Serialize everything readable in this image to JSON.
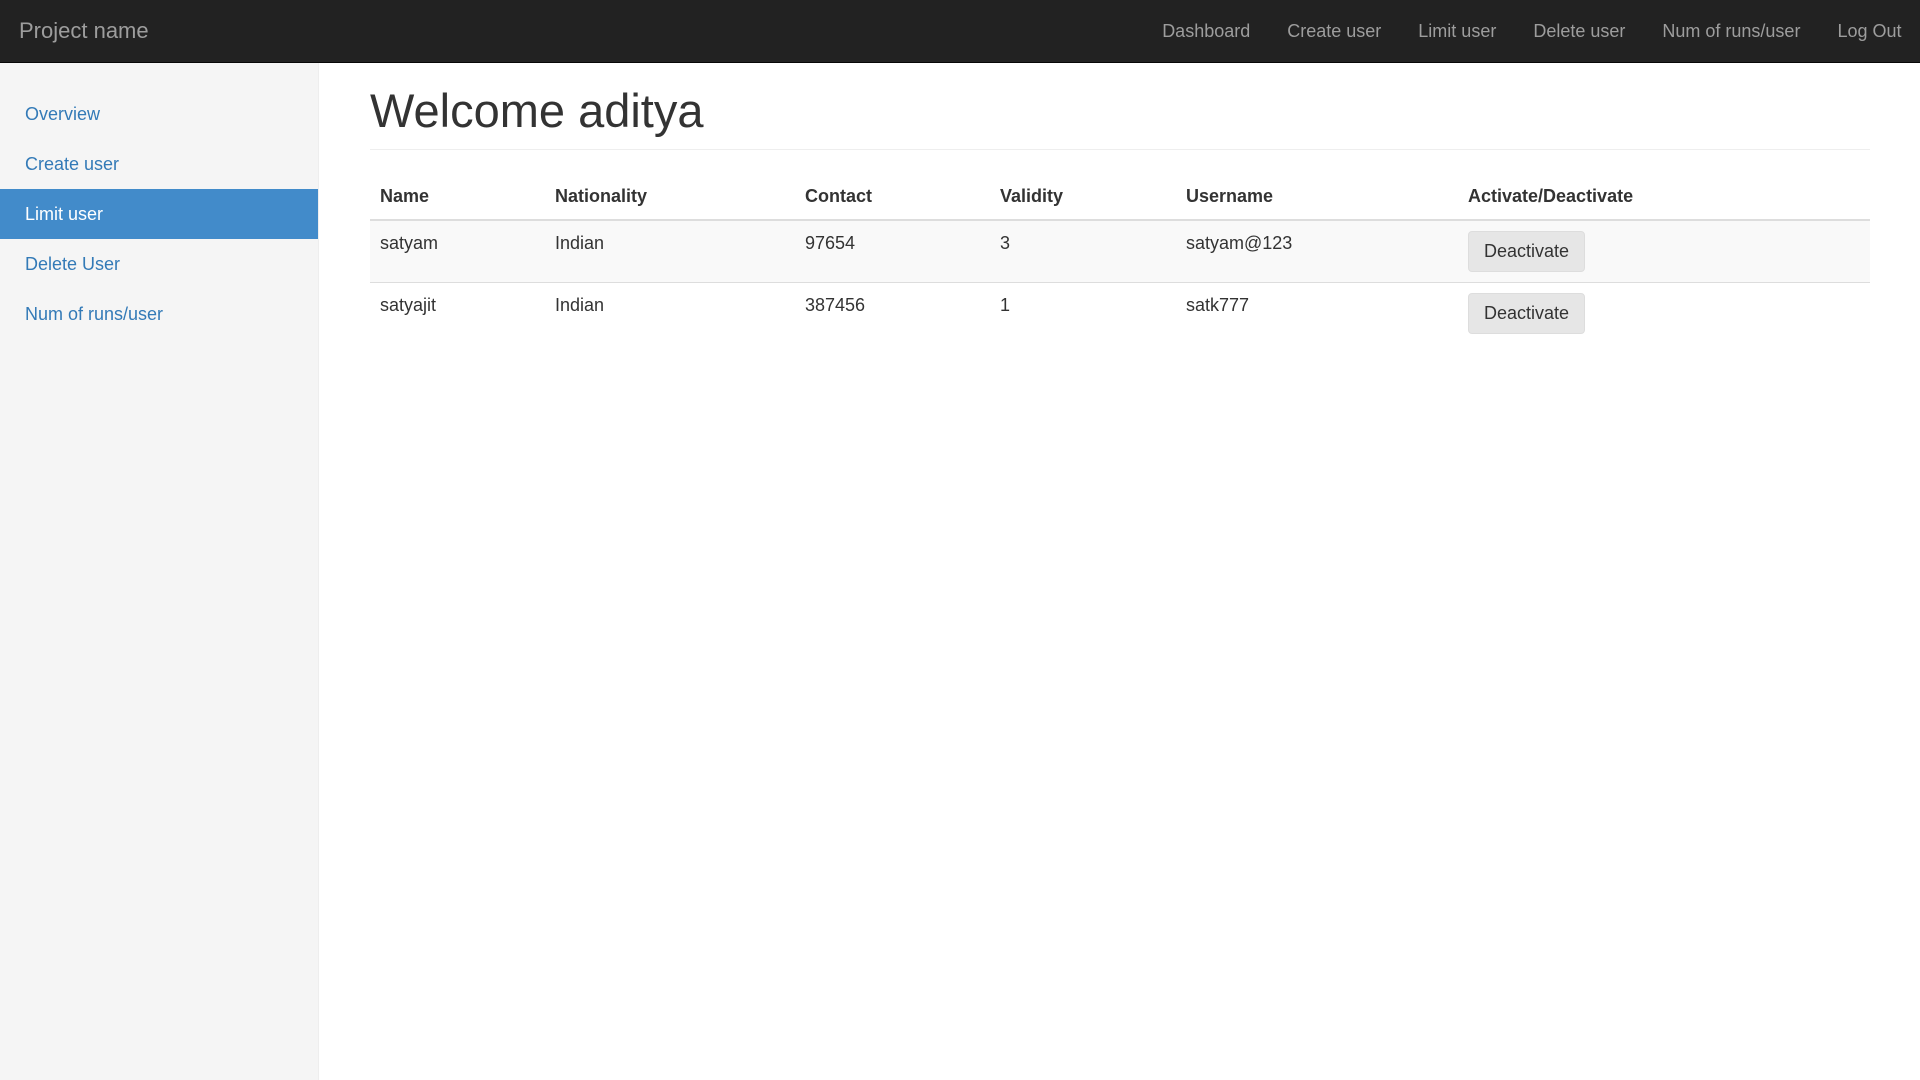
{
  "navbar": {
    "brand": "Project name",
    "links": [
      {
        "label": "Dashboard"
      },
      {
        "label": "Create user"
      },
      {
        "label": "Limit user"
      },
      {
        "label": "Delete user"
      },
      {
        "label": "Num of runs/user"
      },
      {
        "label": "Log Out"
      }
    ]
  },
  "sidebar": {
    "items": [
      {
        "label": "Overview",
        "active": false
      },
      {
        "label": "Create user",
        "active": false
      },
      {
        "label": "Limit user",
        "active": true
      },
      {
        "label": "Delete User",
        "active": false
      },
      {
        "label": "Num of runs/user",
        "active": false
      }
    ]
  },
  "main": {
    "title": "Welcome aditya",
    "table": {
      "headers": [
        "Name",
        "Nationality",
        "Contact",
        "Validity",
        "Username",
        "Activate/Deactivate"
      ],
      "rows": [
        {
          "name": "satyam",
          "nationality": "Indian",
          "contact": "97654",
          "validity": "3",
          "username": "satyam@123",
          "action": "Deactivate"
        },
        {
          "name": "satyajit",
          "nationality": "Indian",
          "contact": "387456",
          "validity": "1",
          "username": "satk777",
          "action": "Deactivate"
        }
      ]
    }
  },
  "colors": {
    "navbar_bg": "#222222",
    "nav_text": "#9d9d9d",
    "sidebar_bg": "#f5f5f5",
    "active_item_bg": "#428bca",
    "link": "#337ab7"
  }
}
